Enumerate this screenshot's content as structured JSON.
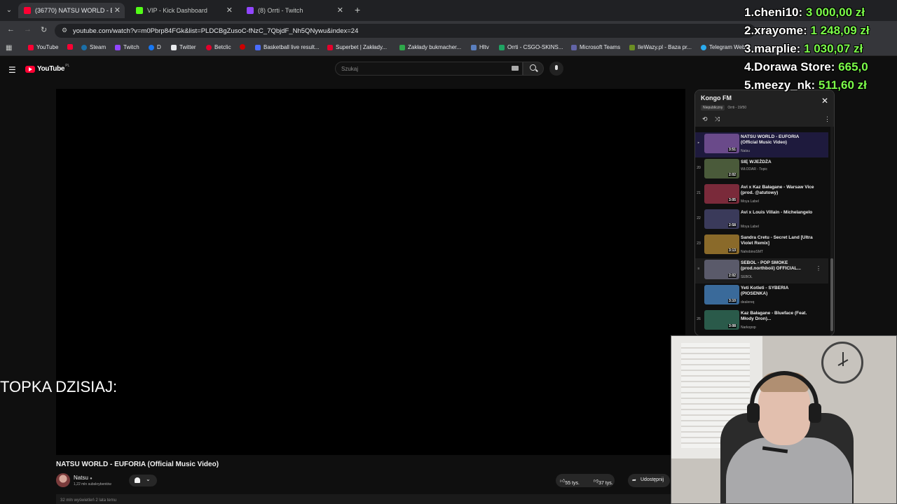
{
  "browser": {
    "tabs": [
      {
        "title": "(36770) NATSU WORLD - EUFO",
        "favicon_color": "#ff0033"
      },
      {
        "title": "VIP - Kick Dashboard",
        "favicon_color": "#53fc18"
      },
      {
        "title": "(8) Orrti - Twitch",
        "favicon_color": "#9146ff"
      }
    ],
    "url": "youtube.com/watch?v=m0Pbrp84FGk&list=PLDCBgZusoC-fNzC_7QbjdF_Nh5QNywu&index=24",
    "bookmarks": [
      "YouTube",
      "Steam",
      "Twitch",
      "D",
      "Twitter",
      "Betclic",
      "Basketball live result...",
      "Superbet | Zakłady...",
      "Zakłady bukmacher...",
      "Hltv",
      "Orrti - CSGO-SKINS...",
      "Microsoft Teams",
      "IleWazy.pl - Baza pr...",
      "Telegram Web"
    ]
  },
  "youtube": {
    "logo_text": "YouTube",
    "logo_region": "PL",
    "search_placeholder": "Szukaj"
  },
  "overlay": {
    "topka_label": "TOPKA DZISIAJ:",
    "leaderboard": [
      {
        "rank_name": "1.cheni10:",
        "amount": "3 000,00 zł"
      },
      {
        "rank_name": "2.xrayome:",
        "amount": "1 248,09 zł"
      },
      {
        "rank_name": "3.marplie:",
        "amount": "1 030,07 zł"
      },
      {
        "rank_name": "4.Dorawa Store:",
        "amount": "665,0"
      },
      {
        "rank_name": "5.meezy_nk:",
        "amount": "511,60 zł"
      }
    ]
  },
  "video": {
    "title": "NATSU WORLD - EUFORIA (Official Music Video)",
    "channel": "Natsu",
    "subscribers": "1,22 mln subskrybentów",
    "likes": "55 tys.",
    "dislikes": "37 tys.",
    "share": "Udostępnij",
    "views_line": "32 mln wyświetleń  2 lata temu"
  },
  "playlist": {
    "title": "Kongo FM",
    "visibility": "Niepubliczny",
    "owner_progress": "Orrti - 19/50",
    "items": [
      {
        "index": "",
        "name": "NATSU WORLD - EUFORIA (Official Music Video)",
        "channel": "Natsu",
        "duration": "3:51",
        "thumb_color": "#6a4a8a"
      },
      {
        "index": "20",
        "name": "SIĘ WJEŻDŻA",
        "channel": "WŁODAR - Topic",
        "duration": "2:02",
        "thumb_color": "#4a5a3a"
      },
      {
        "index": "21",
        "name": "Avi x Kaz Bałagane - Warsaw Vice (prod. @atutowy)",
        "channel": "Moya Label",
        "duration": "3:05",
        "thumb_color": "#7a2a3a"
      },
      {
        "index": "22",
        "name": "Avi x Louis Villain - Michelangelo",
        "channel": "Moya Label",
        "duration": "2:58",
        "thumb_color": "#3a3a5a"
      },
      {
        "index": "23",
        "name": "Sandra Cretu - Secret Land [Ultra Violet Remix]",
        "channel": "NahobinoSMT",
        "duration": "3:13",
        "thumb_color": "#8a6a2a"
      },
      {
        "index": "",
        "name": "SEBOL - POP SMOKE (prod.northboii) OFFICIAL...",
        "channel": "SEBOL",
        "duration": "2:02",
        "thumb_color": "#5a5a6a"
      },
      {
        "index": "",
        "name": "Yeti Kotleti - SYBERIA (PIOSENKA)",
        "channel": "dealereq",
        "duration": "3:10",
        "thumb_color": "#3a6a9a"
      },
      {
        "index": "26",
        "name": "Kaz Bałagane - Blueface (Feat. Młody Dron)...",
        "channel": "Narkopop",
        "duration": "3:08",
        "thumb_color": "#2a5a4a"
      }
    ]
  }
}
